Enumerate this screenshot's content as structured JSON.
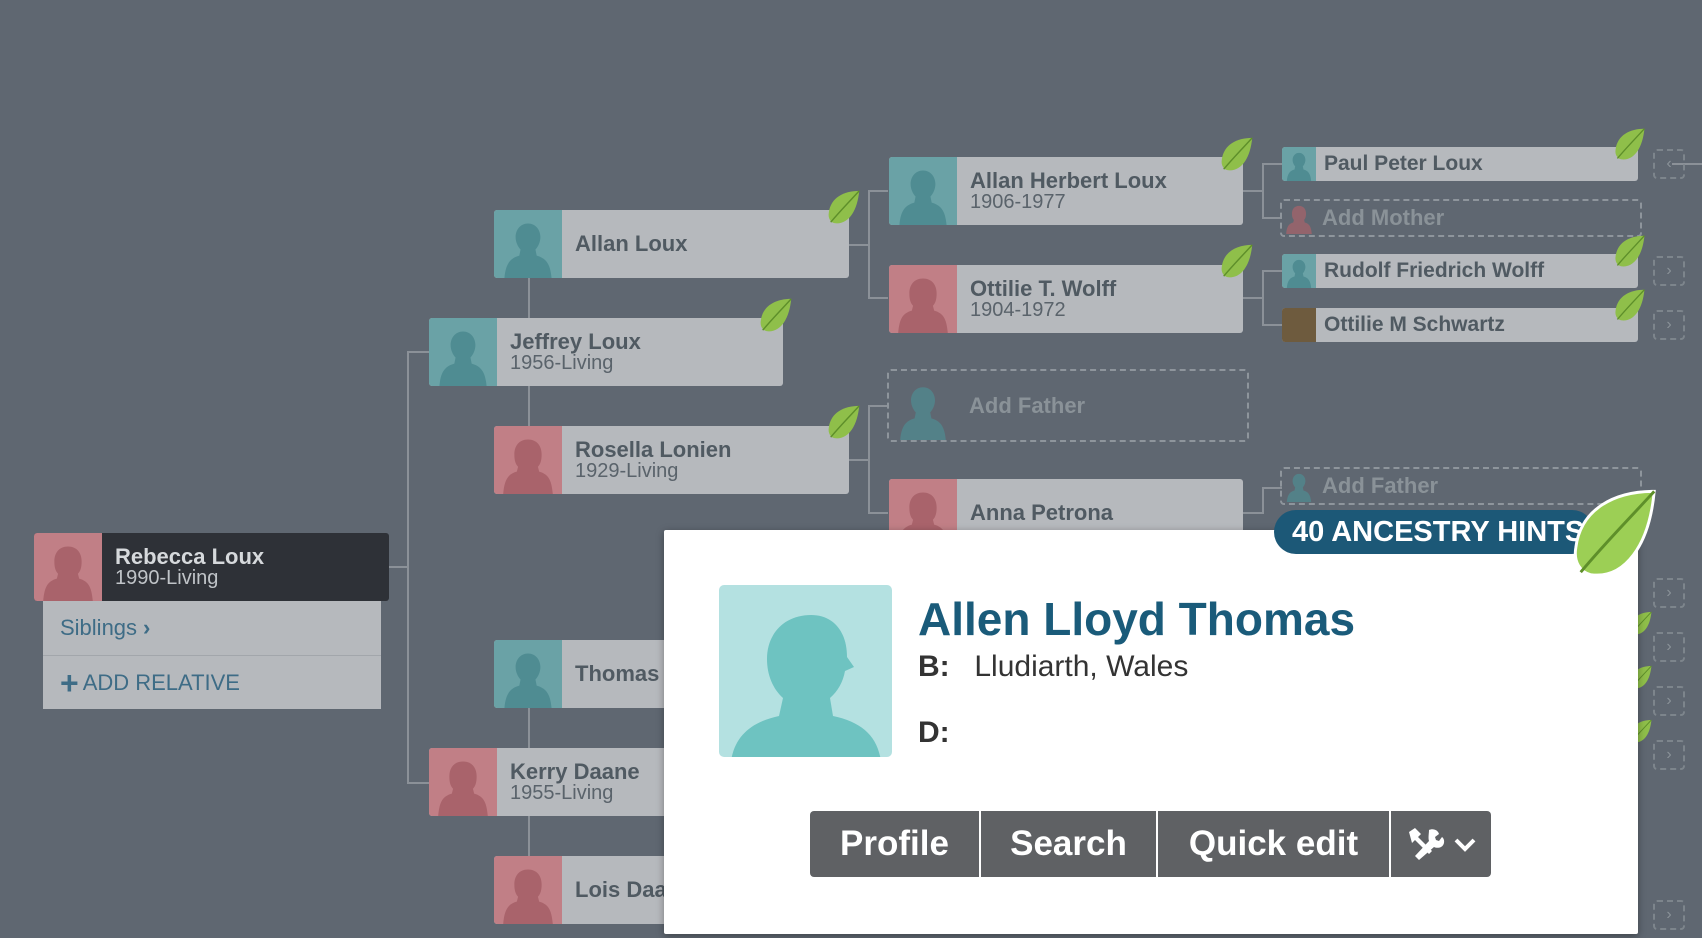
{
  "tree": {
    "focus": {
      "name": "Rebecca Loux",
      "years": "1990-Living"
    },
    "menu": {
      "siblings": "Siblings",
      "siblings_chevron": "›",
      "add_icon": "+",
      "add_relative": "ADD RELATIVE"
    },
    "father": {
      "name": "Jeffrey Loux",
      "years": "1956-Living"
    },
    "mother": {
      "name": "Kerry Daane",
      "years": "1955-Living"
    },
    "paternal_grandfather": {
      "name": "Allan Loux"
    },
    "paternal_grandmother": {
      "name": "Rosella Lonien",
      "years": "1929-Living"
    },
    "maternal_grandfather": {
      "name": "Thomas"
    },
    "maternal_grandmother": {
      "name": "Lois Daa"
    },
    "gen3": {
      "allan_herbert": {
        "name": "Allan Herbert Loux",
        "years": "1906-1977"
      },
      "ottilie_wolff": {
        "name": "Ottilie T. Wolff",
        "years": "1904-1972"
      },
      "add_father": "Add Father",
      "anna": {
        "name": "Anna Petrona"
      }
    },
    "gen4": {
      "paul": "Paul Peter Loux",
      "add_mother": "Add Mother",
      "rudolf": "Rudolf Friedrich Wolff",
      "ottilie_schwartz": "Ottilie M Schwartz",
      "add_father": "Add Father"
    },
    "expand_left_glyph": "‹",
    "expand_right_glyph": "›"
  },
  "popup": {
    "hints_badge": "40 ANCESTRY HINTS",
    "name": "Allen Lloyd Thomas",
    "birth_label": "B:",
    "birth_place": "Lludiarth, Wales",
    "death_label": "D:",
    "death_place": "",
    "buttons": {
      "profile": "Profile",
      "search": "Search",
      "quick_edit": "Quick edit"
    },
    "tools_icon": "tools-icon"
  },
  "colors": {
    "background": "#5f6771",
    "male": "#6aa2a6",
    "female": "#c17f86",
    "accent": "#1a5b7a",
    "hint_leaf": "#8fbf4a"
  }
}
